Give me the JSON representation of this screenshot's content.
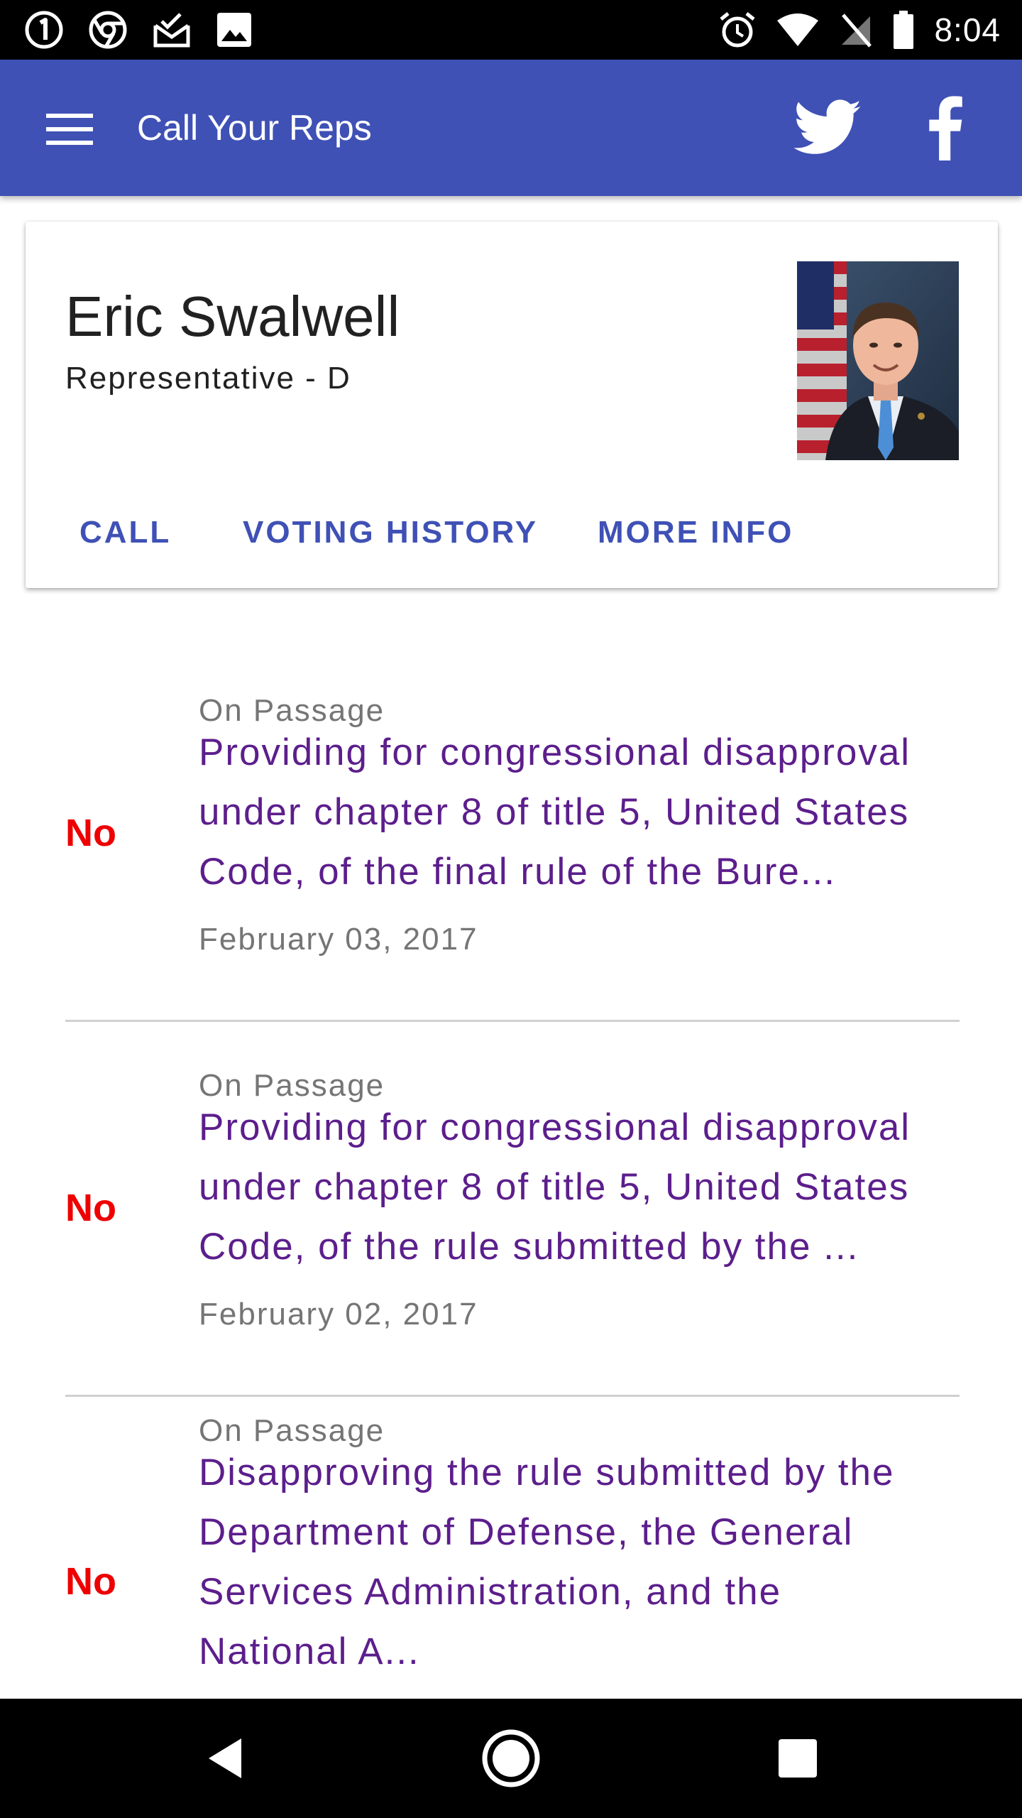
{
  "status_bar": {
    "time": "8:04",
    "left_icons": [
      "one-password-icon",
      "chrome-icon",
      "mail-icon",
      "image-icon"
    ],
    "right_icons": [
      "alarm-icon",
      "wifi-icon",
      "no-signal-icon",
      "battery-icon"
    ]
  },
  "app_bar": {
    "title": "Call Your Reps",
    "menu_icon": "hamburger-menu-icon",
    "actions": [
      "twitter-icon",
      "facebook-icon"
    ],
    "color": "#3f51b5"
  },
  "rep_card": {
    "name": "Eric Swalwell",
    "role": "Representative - D",
    "photo": "representative-portrait",
    "actions": {
      "call": "CALL",
      "voting_history": "VOTING HISTORY",
      "more_info": "MORE INFO"
    }
  },
  "votes": [
    {
      "position": "No",
      "type": "On Passage",
      "description_lines": [
        "Providing for congressional disapproval",
        "under chapter 8 of title 5, United States",
        "Code, of the final rule of the Bure..."
      ],
      "date": "February 03, 2017"
    },
    {
      "position": "No",
      "type": "On Passage",
      "description_lines": [
        "Providing for congressional disapproval",
        "under chapter 8 of title 5, United States",
        "Code, of the rule submitted by the ..."
      ],
      "date": "February 02, 2017"
    },
    {
      "position": "No",
      "type": "On Passage",
      "description_lines": [
        "Disapproving the rule submitted by the",
        "Department of Defense, the General",
        "Services Administration, and the",
        "National A..."
      ],
      "date": ""
    }
  ],
  "colors": {
    "primary": "#3f51b5",
    "vote_no": "#ee0000",
    "description": "#5c1e8c",
    "secondary_text": "#757575"
  },
  "nav_bar": {
    "buttons": [
      "back-icon",
      "home-icon",
      "recents-icon"
    ]
  }
}
